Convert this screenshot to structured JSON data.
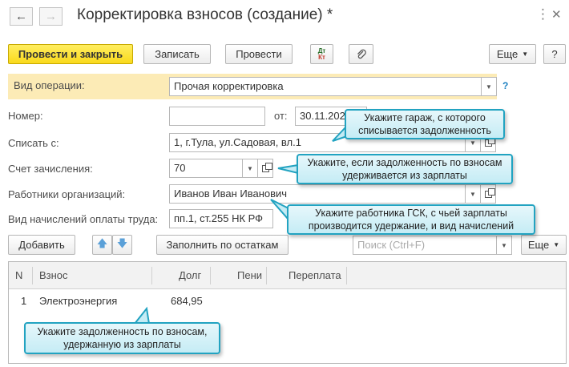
{
  "window": {
    "title": "Корректировка взносов (создание) *"
  },
  "nav": {
    "back_icon": "←",
    "forward_icon": "→"
  },
  "window_controls": {
    "more_icon": "⋮",
    "close_icon": "✕"
  },
  "toolbar": {
    "post_close": "Провести и закрыть",
    "save": "Записать",
    "post": "Провести",
    "dtkt_top": "Дт",
    "dtkt_bottom": "Кт",
    "more": "Еще",
    "help": "?"
  },
  "form": {
    "operation_label": "Вид операции:",
    "operation_value": "Прочая корректировка",
    "number_label": "Номер:",
    "number_value": "",
    "date_label": "от:",
    "date_value": "30.11.2020",
    "write_off_label": "Списать с:",
    "write_off_value": "1, г.Тула, ул.Садовая, вл.1",
    "account_label": "Счет зачисления:",
    "account_value": "70",
    "employees_label": "Работники организаций:",
    "employees_value": "Иванов Иван Иванович",
    "accrual_label": "Вид начислений оплаты труда:",
    "accrual_value": "пп.1, ст.255 НК РФ"
  },
  "table_toolbar": {
    "add": "Добавить",
    "fill": "Заполнить по остаткам",
    "search_placeholder": "Поиск (Ctrl+F)",
    "more": "Еще"
  },
  "table": {
    "columns": [
      "N",
      "Взнос",
      "Долг",
      "Пени",
      "Переплата"
    ],
    "rows": [
      {
        "n": "1",
        "contribution": "Электроэнергия",
        "debt": "684,95",
        "penalty": "",
        "overpayment": ""
      }
    ]
  },
  "callouts": {
    "garage": "Укажите гараж, с которого списывается задолженность",
    "salary": "Укажите, если задолженность по взносам удерживается из зарплаты",
    "employee": "Укажите работника ГСК, с чьей зарплаты производится удержание, и вид начислений",
    "debt": "Укажите задолженность по взносам, удержанную из зарплаты"
  },
  "colors": {
    "primary_button": "#f9d91b",
    "highlight_row": "#fcebb6",
    "callout_border": "#22a3c1",
    "callout_fill": "#d4f1f8"
  }
}
